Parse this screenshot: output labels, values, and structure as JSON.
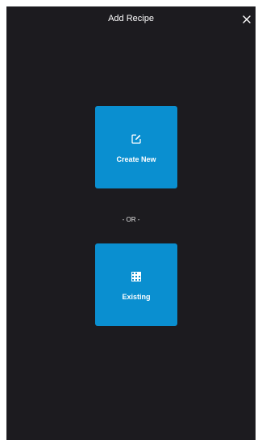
{
  "header": {
    "title": "Add Recipe",
    "close_icon": "close-icon"
  },
  "options": {
    "create_new": {
      "label": "Create New",
      "icon": "edit-icon"
    },
    "separator": "- OR -",
    "existing": {
      "label": "Existing",
      "icon": "grid-icon"
    }
  },
  "colors": {
    "background": "#1c1b1f",
    "tile": "#0a8fd0",
    "text": "#ffffff"
  }
}
